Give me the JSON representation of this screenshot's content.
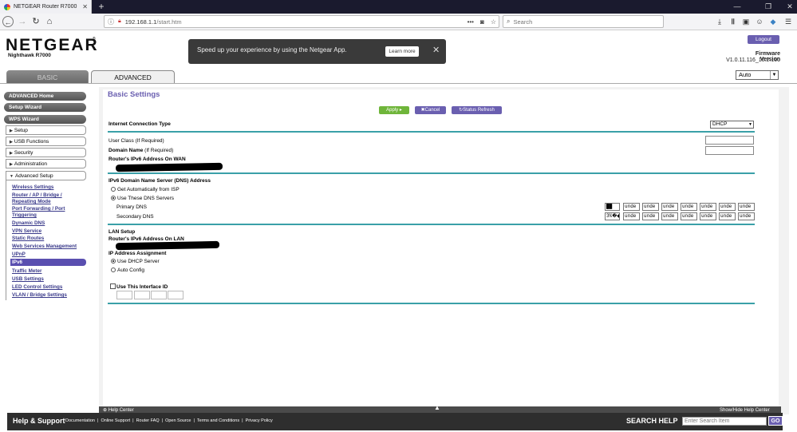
{
  "browser": {
    "tab_title": "NETGEAR Router R7000",
    "url_host": "192.168.1.1",
    "url_path": "/start.htm",
    "search_placeholder": "Search"
  },
  "brand": {
    "logo": "NETGEAR",
    "model": "Nighthawk R7000"
  },
  "toast": {
    "message": "Speed up your experience by using the Netgear App.",
    "learn_more": "Learn more"
  },
  "header": {
    "logout": "Logout",
    "firmware_label": "Firmware Version",
    "firmware_version": "V1.0.11.116_10.2.100",
    "language": "Auto",
    "tabs": {
      "basic": "BASIC",
      "advanced": "ADVANCED"
    }
  },
  "menu": {
    "pills": [
      "ADVANCED Home",
      "Setup Wizard",
      "WPS Wizard"
    ],
    "sections": [
      "Setup",
      "USB Functions",
      "Security",
      "Administration",
      "Advanced Setup"
    ],
    "links": [
      "Wireless Settings",
      "Router / AP / Bridge /",
      "Repeating Mode",
      "Port Forwarding / Port",
      "Triggering",
      "Dynamic DNS",
      "VPN Service",
      "Static Routes",
      "Web Services Management",
      "UPnP"
    ],
    "active": "IPv6",
    "links_after": [
      "Traffic Meter",
      "USB Settings",
      "LED Control Settings",
      "VLAN / Bridge Settings"
    ]
  },
  "main": {
    "title": "Basic Settings",
    "apply": "Apply ▸",
    "cancel": "✖Cancel",
    "refresh": "↻Status Refresh",
    "conn_type_label": "Internet Connection Type",
    "conn_type_value": "DHCP",
    "user_class_label": "User Class (If Required)",
    "domain_name_label_b": "Domain Name",
    "domain_name_label": " (If Required)",
    "wan_addr_label": "Router's IPv6 Address On WAN",
    "dns_heading": "IPv6 Domain Name Server (DNS) Address",
    "dns_auto": "Get Automatically from ISP",
    "dns_manual": "Use These DNS Servers",
    "primary_dns": "Primary DNS",
    "secondary_dns": "Secondary DNS",
    "primary_first": "██",
    "secondary_first": "3%�◆",
    "dns_segment": "unde",
    "lan_heading": "LAN Setup",
    "lan_addr_label": "Router's IPv6 Address On LAN",
    "ip_assign_label": "IP Address Assignment",
    "dhcp_server": "Use DHCP Server",
    "auto_config": "Auto Config",
    "interface_id": "Use This Interface ID"
  },
  "footer": {
    "help_center": "⊕ Help Center",
    "show_hide": "Show/Hide Help Center",
    "help_support": "Help & Support",
    "links": [
      "Documentation",
      "Online Support",
      "Router FAQ",
      "Open Source",
      "Terms and Conditions",
      "Privacy Policy"
    ],
    "search_help": "SEARCH HELP",
    "search_placeholder": "Enter Search Item",
    "go": "GO"
  },
  "colors": {
    "accent": "#6a5fb0",
    "apply": "#6fb53a",
    "separator": "#3aa0a8"
  }
}
